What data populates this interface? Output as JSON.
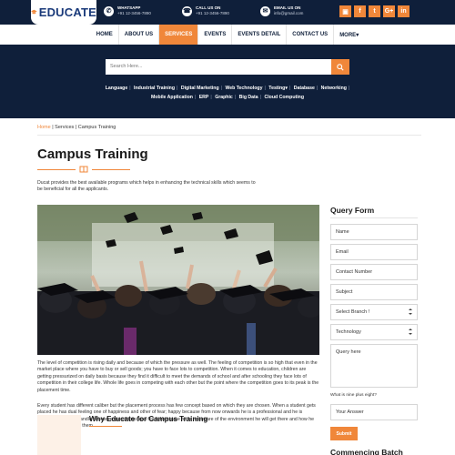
{
  "brand": {
    "logo_text": "EDUCATE"
  },
  "header": {
    "contacts": [
      {
        "label": "WHATSAPP",
        "value": "+91 12-3456-7890",
        "icon": "whatsapp-icon"
      },
      {
        "label": "CALL US ON",
        "value": "+91 12-3456-7890",
        "icon": "phone-icon"
      },
      {
        "label": "EMAIL US ON",
        "value": "info@gmail.com",
        "icon": "mail-icon"
      }
    ],
    "socials": [
      {
        "glyph": "▣",
        "icon": "rss-icon"
      },
      {
        "glyph": "f",
        "icon": "facebook-icon"
      },
      {
        "glyph": "t",
        "icon": "twitter-icon"
      },
      {
        "glyph": "G+",
        "icon": "google-plus-icon"
      },
      {
        "glyph": "in",
        "icon": "linkedin-icon"
      }
    ]
  },
  "nav": {
    "items": [
      "HOME",
      "ABOUT US",
      "SERVICES",
      "EVENTS",
      "EVENTS DETAIL",
      "CONTACT US",
      "MORE▾"
    ],
    "active_index": 2
  },
  "search": {
    "placeholder": "Search Here...",
    "icon": "search-icon"
  },
  "categories": {
    "row1": [
      "Language",
      "Industrial Training",
      "Digital Marketing",
      "Web Technology",
      "Testing▾",
      "Database",
      "Networking"
    ],
    "row2": [
      "Mobile Application",
      "ERP",
      "Graphic",
      "Big Data",
      "Cloud Computing"
    ]
  },
  "breadcrumb": {
    "home": "Home",
    "sep": " | ",
    "services": "Services",
    "current": "Campus Training"
  },
  "page": {
    "title": "Campus Training",
    "intro": "Ducat provides the best available programs which helps in enhancing the technical skills which seems to be beneficial for all the applicants.",
    "body1": "The level of competition is rising daily and because of which the pressure as well. The feeling of competition is so high that even in the market place where you have to buy or sell goods; you have to face lots to competition. When it comes to education, children are getting pressurized on daily basis because they find it difficult to meet the demands of school and after schooling they face lots of competition in their college life. Whole life goes in competing with each other but the point where the competition goes to its peak is the placement time.",
    "body2": "Every student has different caliber but the placement process has few concept based on which they are chosen. When a student gets placed he has dual feeling one of happiness and other of fear; happy because from now onwards he is a professional and he is capable enough to handle his own expenditures and fearful because he is not aware of the environment he will get there and how he should react towards them.",
    "why_title": "Why Educate for Campus Training"
  },
  "query_form": {
    "title": "Query Form",
    "fields": [
      "Name",
      "Email",
      "Contact Number",
      "Subject"
    ],
    "branch_select": "Select Branch !",
    "course_select": "Technology",
    "query_placeholder": "Query here",
    "captcha_label": "What is nine plus eight?",
    "answer_placeholder": "Your Answer",
    "submit": "Submit"
  },
  "sidebar": {
    "next_title": "Commencing Batch"
  },
  "colors": {
    "navy": "#0f1f3a",
    "accent": "#f0873a"
  }
}
